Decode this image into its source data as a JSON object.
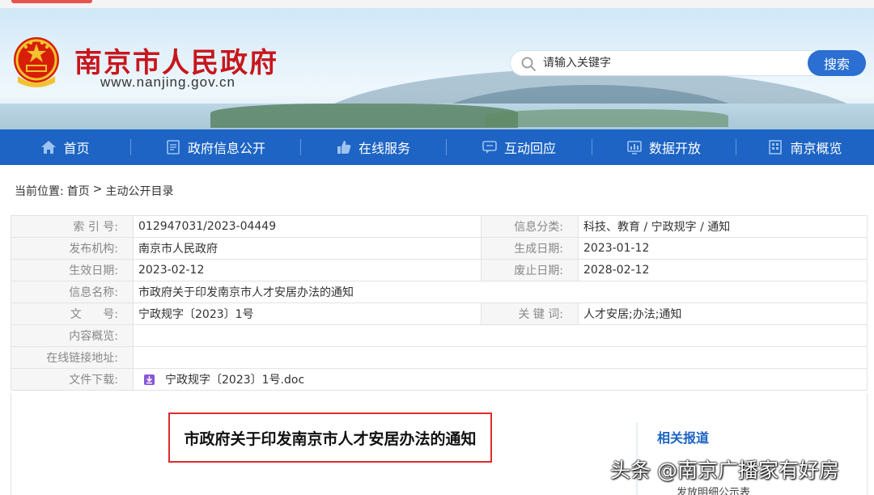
{
  "header": {
    "site_title": "南京市人民政府",
    "site_url": "www.nanjing.gov.cn",
    "search_placeholder": "请输入关键字",
    "search_button": "搜索"
  },
  "nav": {
    "items": [
      {
        "label": "首页",
        "icon": "home-icon"
      },
      {
        "label": "政府信息公开",
        "icon": "document-icon"
      },
      {
        "label": "在线服务",
        "icon": "thumbs-up-icon"
      },
      {
        "label": "互动回应",
        "icon": "chat-icon"
      },
      {
        "label": "数据开放",
        "icon": "chart-icon"
      },
      {
        "label": "南京概览",
        "icon": "building-icon"
      }
    ]
  },
  "breadcrumb": {
    "prefix": "当前位置:",
    "home": "首页",
    "sep": ">",
    "current": "主动公开目录"
  },
  "info": {
    "index_label": "索 引 号:",
    "index_value": "012947031/2023-04449",
    "category_label": "信息分类:",
    "category_value": "科技、教育 / 宁政规字 / 通知",
    "publisher_label": "发布机构:",
    "publisher_value": "南京市人民政府",
    "created_label": "生成日期:",
    "created_value": "2023-01-12",
    "effective_label": "生效日期:",
    "effective_value": "2023-02-12",
    "expiry_label": "废止日期:",
    "expiry_value": "2028-02-12",
    "name_label": "信息名称:",
    "name_value": "市政府关于印发南京市人才安居办法的通知",
    "docno_label": "文      号:",
    "docno_value": "宁政规字〔2023〕1号",
    "keywords_label": "关 键 词:",
    "keywords_value": "人才安居;办法;通知",
    "summary_label": "内容概览:",
    "summary_value": "",
    "link_label": "在线链接地址:",
    "link_value": "",
    "download_label": "文件下载:",
    "download_value": "宁政规字〔2023〕1号.doc"
  },
  "document": {
    "title": "市政府关于印发南京市人才安居办法的通知"
  },
  "related": {
    "title": "相关报道",
    "item": "发放明细公示表"
  },
  "watermark": "头条 @南京广播家有好房",
  "colors": {
    "brand_red": "#c8161d",
    "nav_blue": "#1d64c4",
    "button_blue": "#2a6fd1",
    "highlight_border": "#e02b2b"
  }
}
